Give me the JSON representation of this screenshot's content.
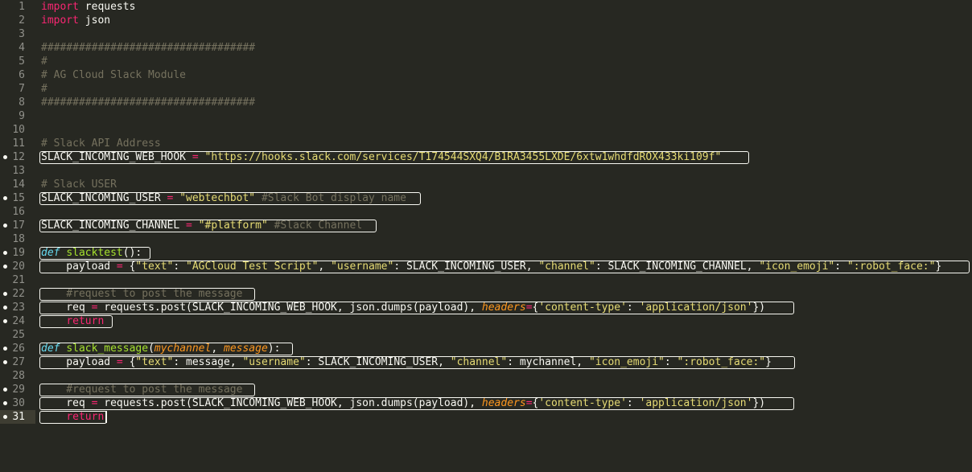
{
  "line_numbers": [
    "1",
    "2",
    "3",
    "4",
    "5",
    "6",
    "7",
    "8",
    "9",
    "10",
    "11",
    "12",
    "13",
    "14",
    "15",
    "16",
    "17",
    "18",
    "19",
    "20",
    "21",
    "22",
    "23",
    "24",
    "25",
    "26",
    "27",
    "28",
    "29",
    "30",
    "31"
  ],
  "code": {
    "l1": [
      "import",
      " requests"
    ],
    "l2": [
      "import",
      " json"
    ],
    "l4": "##################################",
    "l5": "#",
    "l6": "# AG Cloud Slack Module",
    "l7": "#",
    "l8": "##################################",
    "l11": "# Slack API Address",
    "l12": [
      "SLACK_INCOMING_WEB_HOOK",
      " = ",
      "\"https://hooks.slack.com/services/T174544SXQ4/B1RA3455LXDE/6xtw1whdfdROX433ki109f\""
    ],
    "l14": "# Slack USER",
    "l15": [
      "SLACK_INCOMING_USER",
      " = ",
      "\"webtechbot\"",
      " #Slack Bot display name"
    ],
    "l17": [
      "SLACK_INCOMING_CHANNEL",
      " = ",
      "\"#platform\"",
      " #Slack Channel"
    ],
    "l19": [
      "def",
      " ",
      "slacktest",
      "():"
    ],
    "l20": [
      "    payload",
      " = ",
      "{",
      "\"text\"",
      ": ",
      "\"AGCloud Test Script\"",
      ", ",
      "\"username\"",
      ": SLACK_INCOMING_USER, ",
      "\"channel\"",
      ": SLACK_INCOMING_CHANNEL, ",
      "\"icon_emoji\"",
      ": ",
      "\":robot_face:\"",
      "}"
    ],
    "l22": "    #request to post the message",
    "l23": [
      "    req",
      " = ",
      "requests.post(SLACK_INCOMING_WEB_HOOK, json.dumps(payload), ",
      "headers",
      "=",
      "{",
      "'content-type'",
      ": ",
      "'application/json'",
      "})"
    ],
    "l24": [
      "    ",
      "return"
    ],
    "l26": [
      "def",
      " ",
      "slack_message",
      "(",
      "mychannel",
      ", ",
      "message",
      "):"
    ],
    "l27": [
      "    payload",
      " = ",
      "{",
      "\"text\"",
      ": message, ",
      "\"username\"",
      ": SLACK_INCOMING_USER, ",
      "\"channel\"",
      ": mychannel, ",
      "\"icon_emoji\"",
      ": ",
      "\":robot_face:\"",
      "}"
    ],
    "l29": "    #request to post the message",
    "l30": [
      "    req",
      " = ",
      "requests.post(SLACK_INCOMING_WEB_HOOK, json.dumps(payload), ",
      "headers",
      "=",
      "{",
      "'content-type'",
      ": ",
      "'application/json'",
      "})"
    ],
    "l31": [
      "    ",
      "return"
    ]
  },
  "current_line": "31",
  "colors": {
    "background": "#272822",
    "keyword": "#f92672",
    "string": "#e6db74",
    "comment": "#75715e",
    "function": "#a6e22e",
    "builtin": "#66d9ef",
    "parameter": "#fd971f"
  }
}
